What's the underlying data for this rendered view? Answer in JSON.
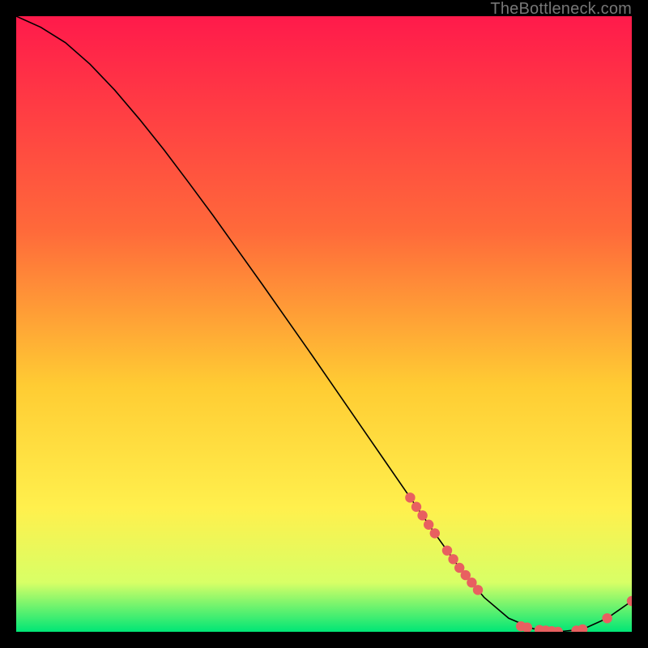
{
  "watermark": "TheBottleneck.com",
  "colors": {
    "background": "#000000",
    "gradient_top": "#ff1a4b",
    "gradient_mid1": "#ff6a3a",
    "gradient_mid2": "#ffcc33",
    "gradient_mid3": "#fff04d",
    "gradient_mid4": "#d8ff66",
    "gradient_bottom": "#00e676",
    "curve": "#000000",
    "marker": "#e86060"
  },
  "chart_data": {
    "type": "line",
    "title": "",
    "xlabel": "",
    "ylabel": "",
    "xlim": [
      0,
      100
    ],
    "ylim": [
      0,
      100
    ],
    "curve": {
      "x": [
        0,
        4,
        8,
        12,
        16,
        20,
        24,
        28,
        32,
        36,
        40,
        44,
        48,
        52,
        56,
        60,
        64,
        68,
        72,
        76,
        80,
        84,
        88,
        92,
        96,
        100
      ],
      "y": [
        100,
        98.2,
        95.7,
        92.2,
        88.0,
        83.3,
        78.3,
        73.0,
        67.6,
        62.0,
        56.4,
        50.7,
        45.0,
        39.2,
        33.4,
        27.6,
        21.8,
        16.0,
        10.4,
        5.6,
        2.2,
        0.5,
        0.0,
        0.4,
        2.2,
        5.0
      ]
    },
    "markers": {
      "x": [
        64,
        65,
        66,
        67,
        68,
        70,
        71,
        72,
        73,
        74,
        75,
        82,
        83,
        85,
        86,
        87,
        88,
        91,
        92,
        96,
        100
      ],
      "y": [
        21.8,
        20.3,
        18.9,
        17.4,
        16.0,
        13.2,
        11.8,
        10.4,
        9.2,
        8.0,
        6.8,
        0.9,
        0.7,
        0.3,
        0.2,
        0.1,
        0.0,
        0.2,
        0.4,
        2.2,
        5.0
      ]
    }
  }
}
